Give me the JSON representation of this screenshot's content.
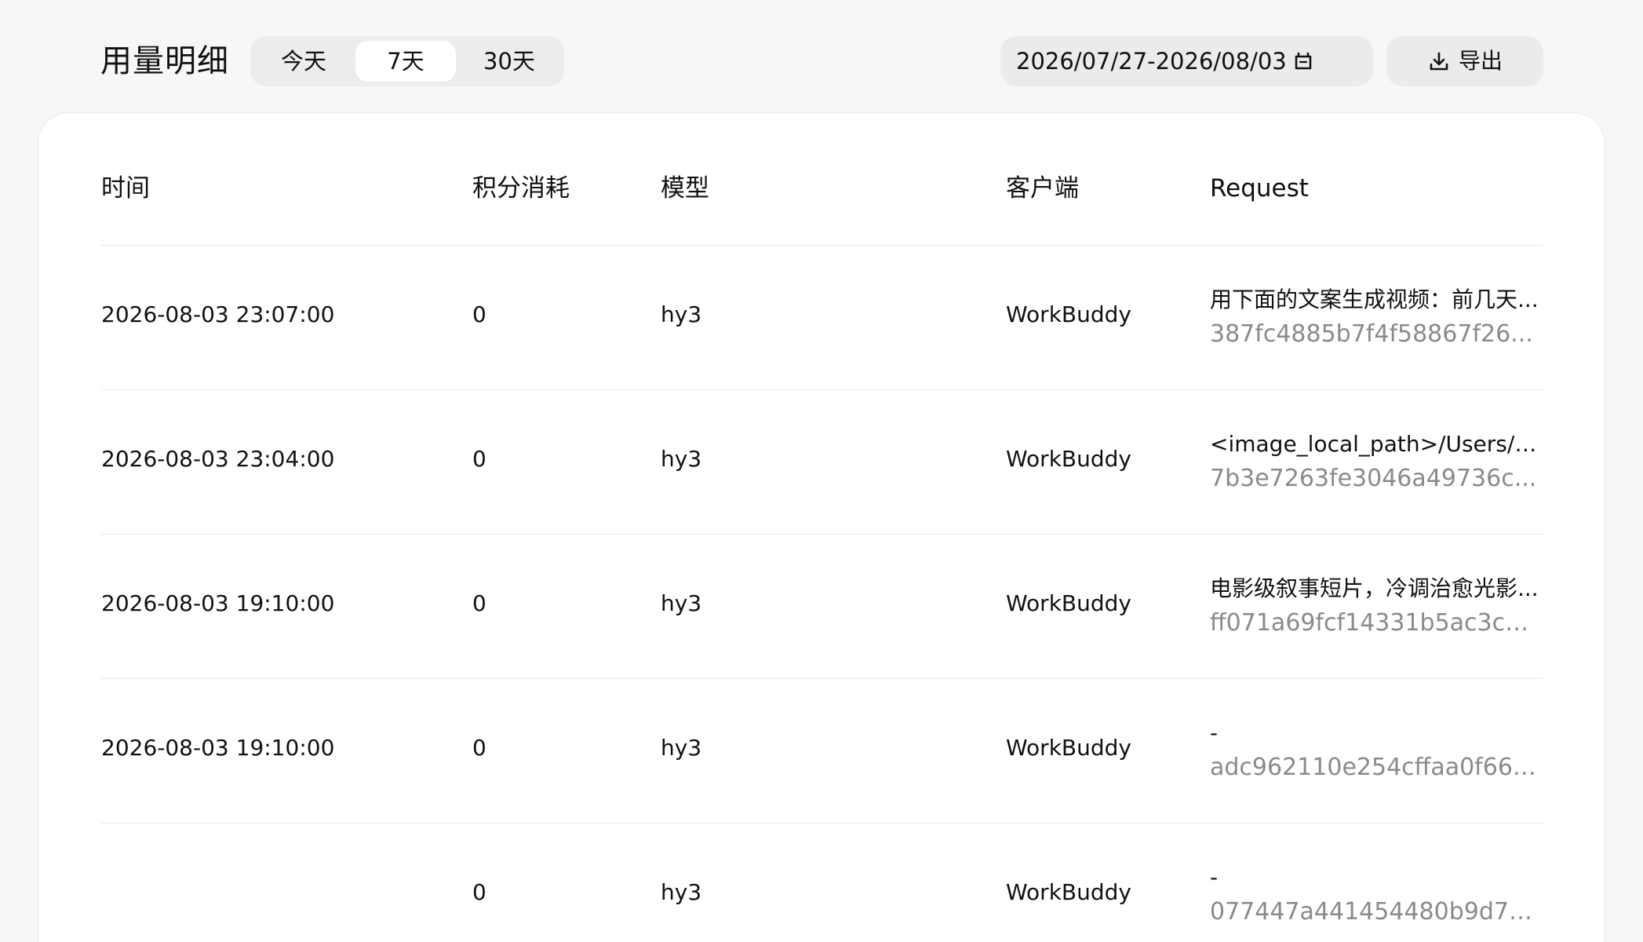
{
  "header": {
    "title": "用量明细",
    "range_tabs": [
      {
        "label": "今天",
        "selected": false
      },
      {
        "label": "7天",
        "selected": true
      },
      {
        "label": "30天",
        "selected": false
      }
    ],
    "date_range": "2026/07/27-2026/08/03",
    "export_label": "导出"
  },
  "table": {
    "columns": {
      "time": "时间",
      "credits": "积分消耗",
      "model": "模型",
      "client": "客户端",
      "request": "Request"
    },
    "rows": [
      {
        "time": "2026-08-03 23:07:00",
        "credits": "0",
        "model": "hy3",
        "client": "WorkBuddy",
        "request_text": "用下面的文案生成视频：前几天...",
        "request_id": "387fc4885b7f4f58867f26..."
      },
      {
        "time": "2026-08-03 23:04:00",
        "credits": "0",
        "model": "hy3",
        "client": "WorkBuddy",
        "request_text": "<image_local_path>/Users/le...",
        "request_id": "7b3e7263fe3046a49736c..."
      },
      {
        "time": "2026-08-03 19:10:00",
        "credits": "0",
        "model": "hy3",
        "client": "WorkBuddy",
        "request_text": "电影级叙事短片，冷调治愈光影...",
        "request_id": "ff071a69fcf14331b5ac3cd..."
      },
      {
        "time": "2026-08-03 19:10:00",
        "credits": "0",
        "model": "hy3",
        "client": "WorkBuddy",
        "request_text": "-",
        "request_id": "adc962110e254cffaa0f661..."
      },
      {
        "time": "",
        "credits": "0",
        "model": "hy3",
        "client": "WorkBuddy",
        "request_text": "-",
        "request_id": "077447a441454480b9d79..."
      }
    ]
  }
}
